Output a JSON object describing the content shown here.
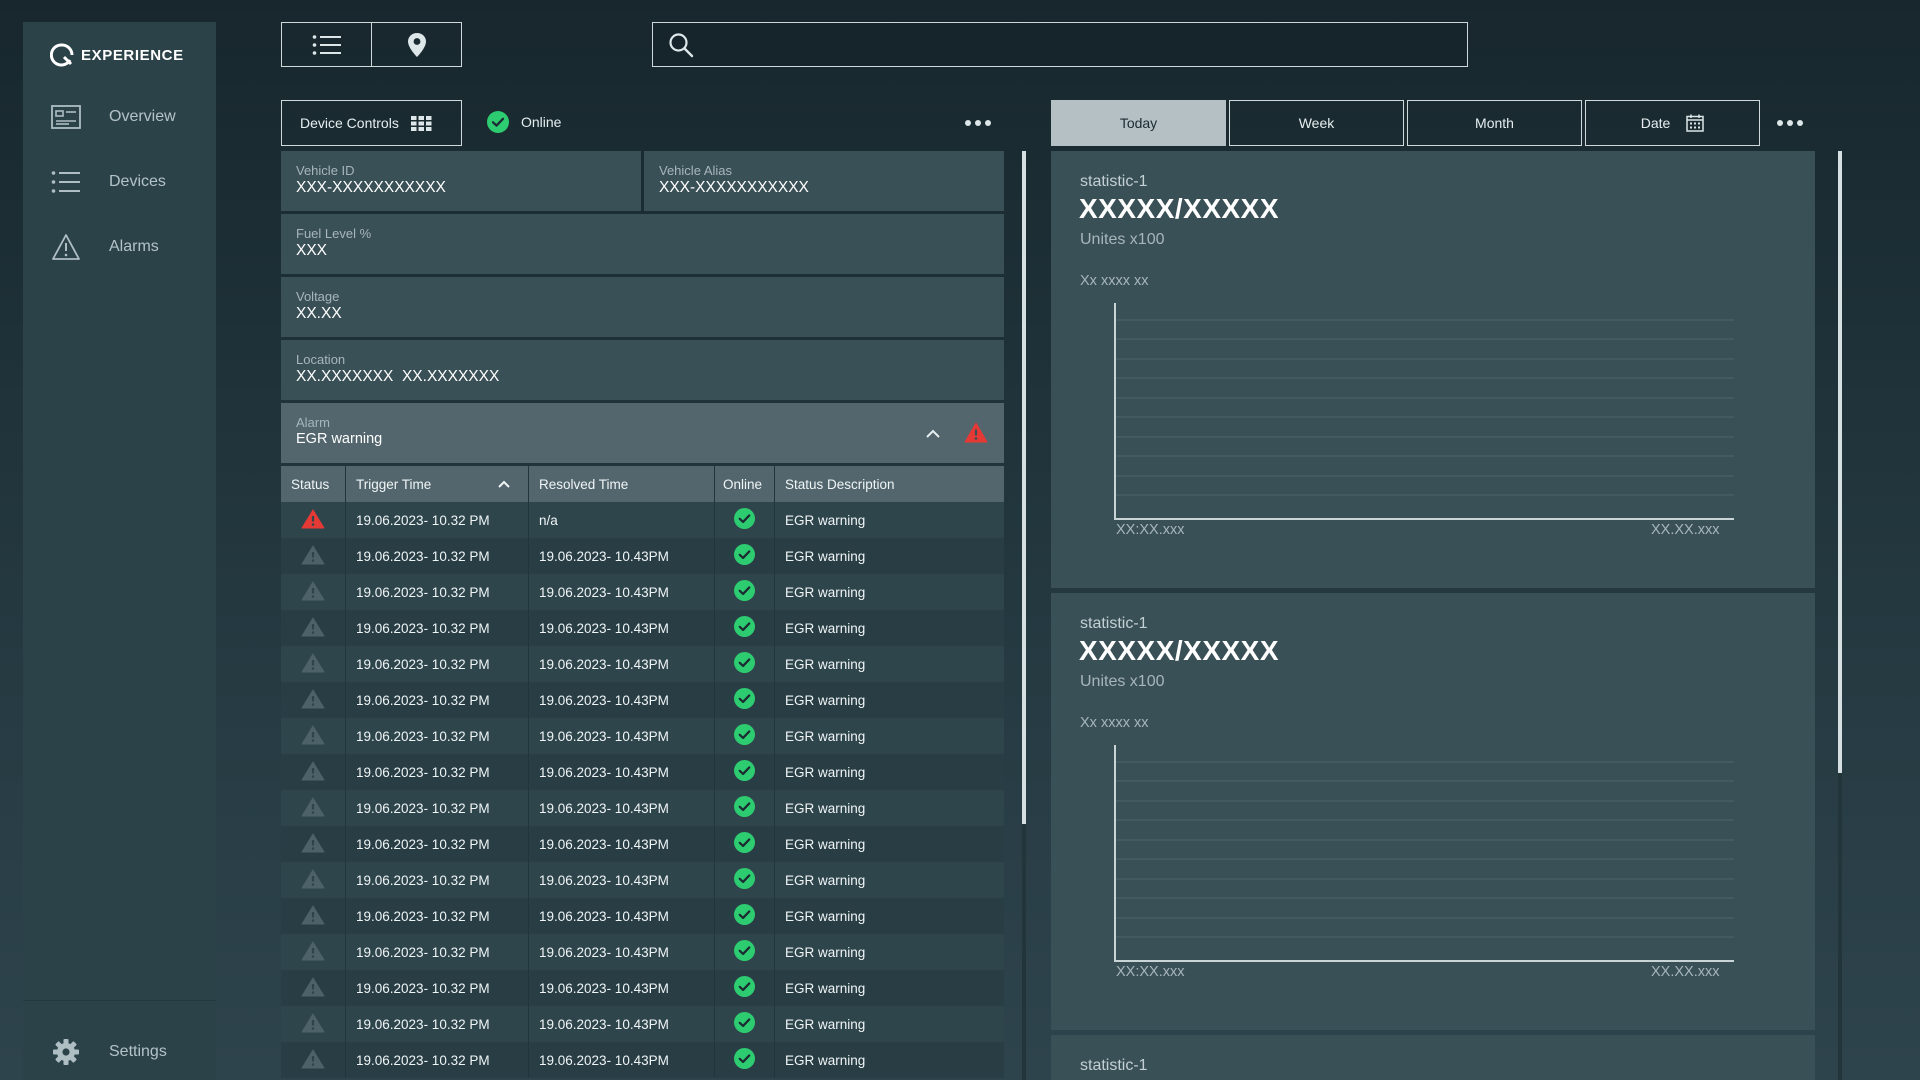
{
  "app": {
    "logo_text": "EXPERIENCE"
  },
  "sidebar": {
    "items": [
      {
        "label": "Overview",
        "icon": "dashboard-icon"
      },
      {
        "label": "Devices",
        "icon": "list-icon"
      },
      {
        "label": "Alarms",
        "icon": "warning-icon"
      }
    ],
    "settings_label": "Settings"
  },
  "search": {
    "placeholder": "",
    "value": ""
  },
  "device": {
    "controls_label": "Device Controls",
    "status_label": "Online",
    "fields": {
      "vehicle_id_label": "Vehicle ID",
      "vehicle_id": "XXX-XXXXXXXXXXX",
      "vehicle_alias_label": "Vehicle Alias",
      "vehicle_alias": "XXX-XXXXXXXXXXX",
      "fuel_label": "Fuel Level %",
      "fuel": "XXX",
      "voltage_label": "Voltage",
      "voltage": "XX.XX",
      "location_label": "Location",
      "location": "XX.XXXXXXX  XX.XXXXXXX"
    },
    "alarm": {
      "label": "Alarm",
      "value": "EGR warning"
    }
  },
  "table": {
    "headers": [
      "Status",
      "Trigger Time",
      "Resolved Time",
      "Online",
      "Status Description"
    ],
    "rows": [
      {
        "status": "active",
        "trigger": "19.06.2023- 10.32 PM",
        "resolved": "n/a",
        "desc": "EGR warning"
      },
      {
        "status": "resolved",
        "trigger": "19.06.2023- 10.32 PM",
        "resolved": "19.06.2023- 10.43PM",
        "desc": "EGR warning"
      },
      {
        "status": "resolved",
        "trigger": "19.06.2023- 10.32 PM",
        "resolved": "19.06.2023- 10.43PM",
        "desc": "EGR warning"
      },
      {
        "status": "resolved",
        "trigger": "19.06.2023- 10.32 PM",
        "resolved": "19.06.2023- 10.43PM",
        "desc": "EGR warning"
      },
      {
        "status": "resolved",
        "trigger": "19.06.2023- 10.32 PM",
        "resolved": "19.06.2023- 10.43PM",
        "desc": "EGR warning"
      },
      {
        "status": "resolved",
        "trigger": "19.06.2023- 10.32 PM",
        "resolved": "19.06.2023- 10.43PM",
        "desc": "EGR warning"
      },
      {
        "status": "resolved",
        "trigger": "19.06.2023- 10.32 PM",
        "resolved": "19.06.2023- 10.43PM",
        "desc": "EGR warning"
      },
      {
        "status": "resolved",
        "trigger": "19.06.2023- 10.32 PM",
        "resolved": "19.06.2023- 10.43PM",
        "desc": "EGR warning"
      },
      {
        "status": "resolved",
        "trigger": "19.06.2023- 10.32 PM",
        "resolved": "19.06.2023- 10.43PM",
        "desc": "EGR warning"
      },
      {
        "status": "resolved",
        "trigger": "19.06.2023- 10.32 PM",
        "resolved": "19.06.2023- 10.43PM",
        "desc": "EGR warning"
      },
      {
        "status": "resolved",
        "trigger": "19.06.2023- 10.32 PM",
        "resolved": "19.06.2023- 10.43PM",
        "desc": "EGR warning"
      },
      {
        "status": "resolved",
        "trigger": "19.06.2023- 10.32 PM",
        "resolved": "19.06.2023- 10.43PM",
        "desc": "EGR warning"
      },
      {
        "status": "resolved",
        "trigger": "19.06.2023- 10.32 PM",
        "resolved": "19.06.2023- 10.43PM",
        "desc": "EGR warning"
      },
      {
        "status": "resolved",
        "trigger": "19.06.2023- 10.32 PM",
        "resolved": "19.06.2023- 10.43PM",
        "desc": "EGR warning"
      },
      {
        "status": "resolved",
        "trigger": "19.06.2023- 10.32 PM",
        "resolved": "19.06.2023- 10.43PM",
        "desc": "EGR warning"
      },
      {
        "status": "resolved",
        "trigger": "19.06.2023- 10.32 PM",
        "resolved": "19.06.2023- 10.43PM",
        "desc": "EGR warning"
      }
    ]
  },
  "time_tabs": [
    {
      "label": "Today",
      "active": true
    },
    {
      "label": "Week",
      "active": false
    },
    {
      "label": "Month",
      "active": false
    },
    {
      "label": "Date",
      "active": false,
      "icon": "calendar-icon"
    }
  ],
  "stats": [
    {
      "label": "statistic-1",
      "value": "XXXXX/XXXXX",
      "unit": "Unites x100",
      "ylabel": "Xx xxxx xx",
      "x_start": "XX:XX.xxx",
      "x_end": "XX.XX.xxx"
    },
    {
      "label": "statistic-1",
      "value": "XXXXX/XXXXX",
      "unit": "Unites x100",
      "ylabel": "Xx xxxx xx",
      "x_start": "XX:XX.xxx",
      "x_end": "XX.XX.xxx"
    }
  ],
  "stat_partial_label": "statistic-1",
  "colors": {
    "accent_green": "#2ecc71",
    "alert_red": "#e53935",
    "active_tab": "#b4c0c3"
  }
}
